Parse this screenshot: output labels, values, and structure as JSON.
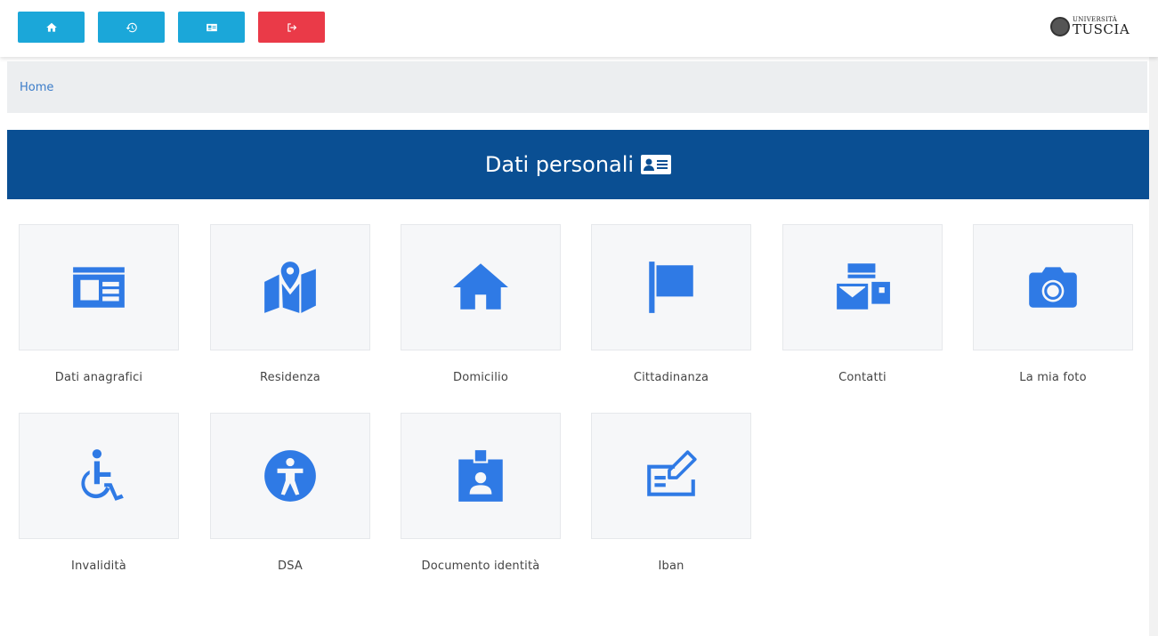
{
  "toolbar": {
    "buttons": [
      {
        "icon": "home-icon",
        "color": "#1ba7d9"
      },
      {
        "icon": "history-icon",
        "color": "#1ba7d9"
      },
      {
        "icon": "id-card-icon",
        "color": "#1ba7d9"
      },
      {
        "icon": "sign-out-icon",
        "color": "#ea3a48"
      }
    ],
    "logo": {
      "small": "UNIVERSITÀ",
      "big": "TUSCIA"
    }
  },
  "breadcrumb": {
    "home": "Home"
  },
  "banner": {
    "title": "Dati personali",
    "color": "#0a4f93",
    "icon": "id-card-icon"
  },
  "tiles": [
    {
      "label": "Dati anagrafici",
      "icon": "id-card-icon"
    },
    {
      "label": "Residenza",
      "icon": "map-marker-icon"
    },
    {
      "label": "Domicilio",
      "icon": "home-icon"
    },
    {
      "label": "Cittadinanza",
      "icon": "flag-icon"
    },
    {
      "label": "Contatti",
      "icon": "mail-bulk-icon"
    },
    {
      "label": "La mia foto",
      "icon": "camera-icon"
    },
    {
      "label": "Invalidità",
      "icon": "wheelchair-icon"
    },
    {
      "label": "DSA",
      "icon": "universal-access-icon"
    },
    {
      "label": "Documento identità",
      "icon": "id-badge-icon"
    },
    {
      "label": "Iban",
      "icon": "money-check-edit-icon"
    }
  ],
  "colors": {
    "accent": "#2f7ae5",
    "button": "#1ba7d9",
    "logout": "#ea3a48"
  }
}
